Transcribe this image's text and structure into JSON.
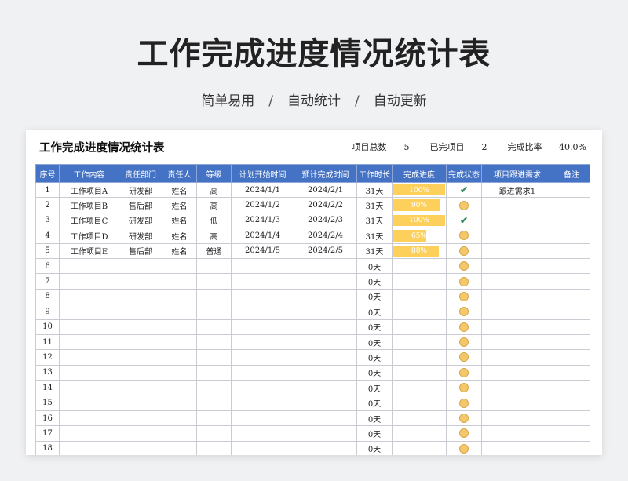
{
  "page": {
    "title": "工作完成进度情况统计表",
    "subtitle_items": [
      "简单易用",
      "自动统计",
      "自动更新"
    ],
    "separator": "/"
  },
  "sheet": {
    "title": "工作完成进度情况统计表",
    "stats": [
      {
        "label": "项目总数",
        "value": "5"
      },
      {
        "label": "已完项目",
        "value": "2"
      },
      {
        "label": "完成比率",
        "value": "40.0%"
      }
    ],
    "columns": [
      "序号",
      "工作内容",
      "责任部门",
      "责任人",
      "等级",
      "计划开始时间",
      "预计完成时间",
      "工作时长",
      "完成进度",
      "完成状态",
      "项目跟进需求",
      "备注"
    ],
    "rows": [
      {
        "no": "1",
        "task": "工作项目A",
        "dept": "研发部",
        "owner": "姓名",
        "level": "高",
        "start": "2024/1/1",
        "end": "2024/2/1",
        "duration": "31天",
        "progress": 1.0,
        "progress_label": "100%",
        "status": "check",
        "follow": "跟进需求1",
        "note": ""
      },
      {
        "no": "2",
        "task": "工作项目B",
        "dept": "售后部",
        "owner": "姓名",
        "level": "高",
        "start": "2024/1/2",
        "end": "2024/2/2",
        "duration": "31天",
        "progress": 0.9,
        "progress_label": "90%",
        "status": "dot",
        "follow": "",
        "note": ""
      },
      {
        "no": "3",
        "task": "工作项目C",
        "dept": "研发部",
        "owner": "姓名",
        "level": "低",
        "start": "2024/1/3",
        "end": "2024/2/3",
        "duration": "31天",
        "progress": 1.0,
        "progress_label": "100%",
        "status": "check",
        "follow": "",
        "note": ""
      },
      {
        "no": "4",
        "task": "工作项目D",
        "dept": "研发部",
        "owner": "姓名",
        "level": "高",
        "start": "2024/1/4",
        "end": "2024/2/4",
        "duration": "31天",
        "progress": 0.65,
        "progress_label": "65%",
        "status": "dot",
        "follow": "",
        "note": ""
      },
      {
        "no": "5",
        "task": "工作项目E",
        "dept": "售后部",
        "owner": "姓名",
        "level": "普通",
        "start": "2024/1/5",
        "end": "2024/2/5",
        "duration": "31天",
        "progress": 0.88,
        "progress_label": "88%",
        "status": "dot",
        "follow": "",
        "note": ""
      },
      {
        "no": "6",
        "task": "",
        "dept": "",
        "owner": "",
        "level": "",
        "start": "",
        "end": "",
        "duration": "0天",
        "progress": 0,
        "progress_label": "",
        "status": "dot",
        "follow": "",
        "note": ""
      },
      {
        "no": "7",
        "task": "",
        "dept": "",
        "owner": "",
        "level": "",
        "start": "",
        "end": "",
        "duration": "0天",
        "progress": 0,
        "progress_label": "",
        "status": "dot",
        "follow": "",
        "note": ""
      },
      {
        "no": "8",
        "task": "",
        "dept": "",
        "owner": "",
        "level": "",
        "start": "",
        "end": "",
        "duration": "0天",
        "progress": 0,
        "progress_label": "",
        "status": "dot",
        "follow": "",
        "note": ""
      },
      {
        "no": "9",
        "task": "",
        "dept": "",
        "owner": "",
        "level": "",
        "start": "",
        "end": "",
        "duration": "0天",
        "progress": 0,
        "progress_label": "",
        "status": "dot",
        "follow": "",
        "note": ""
      },
      {
        "no": "10",
        "task": "",
        "dept": "",
        "owner": "",
        "level": "",
        "start": "",
        "end": "",
        "duration": "0天",
        "progress": 0,
        "progress_label": "",
        "status": "dot",
        "follow": "",
        "note": ""
      },
      {
        "no": "11",
        "task": "",
        "dept": "",
        "owner": "",
        "level": "",
        "start": "",
        "end": "",
        "duration": "0天",
        "progress": 0,
        "progress_label": "",
        "status": "dot",
        "follow": "",
        "note": ""
      },
      {
        "no": "12",
        "task": "",
        "dept": "",
        "owner": "",
        "level": "",
        "start": "",
        "end": "",
        "duration": "0天",
        "progress": 0,
        "progress_label": "",
        "status": "dot",
        "follow": "",
        "note": ""
      },
      {
        "no": "13",
        "task": "",
        "dept": "",
        "owner": "",
        "level": "",
        "start": "",
        "end": "",
        "duration": "0天",
        "progress": 0,
        "progress_label": "",
        "status": "dot",
        "follow": "",
        "note": ""
      },
      {
        "no": "14",
        "task": "",
        "dept": "",
        "owner": "",
        "level": "",
        "start": "",
        "end": "",
        "duration": "0天",
        "progress": 0,
        "progress_label": "",
        "status": "dot",
        "follow": "",
        "note": ""
      },
      {
        "no": "15",
        "task": "",
        "dept": "",
        "owner": "",
        "level": "",
        "start": "",
        "end": "",
        "duration": "0天",
        "progress": 0,
        "progress_label": "",
        "status": "dot",
        "follow": "",
        "note": ""
      },
      {
        "no": "16",
        "task": "",
        "dept": "",
        "owner": "",
        "level": "",
        "start": "",
        "end": "",
        "duration": "0天",
        "progress": 0,
        "progress_label": "",
        "status": "dot",
        "follow": "",
        "note": ""
      },
      {
        "no": "17",
        "task": "",
        "dept": "",
        "owner": "",
        "level": "",
        "start": "",
        "end": "",
        "duration": "0天",
        "progress": 0,
        "progress_label": "",
        "status": "dot",
        "follow": "",
        "note": ""
      },
      {
        "no": "18",
        "task": "",
        "dept": "",
        "owner": "",
        "level": "",
        "start": "",
        "end": "",
        "duration": "0天",
        "progress": 0,
        "progress_label": "",
        "status": "dot",
        "follow": "",
        "note": ""
      }
    ]
  },
  "colors": {
    "header_bg": "#4472c4",
    "bar": "#fcd05a",
    "check": "#3a8c5c",
    "dot": "#f4c76a"
  }
}
